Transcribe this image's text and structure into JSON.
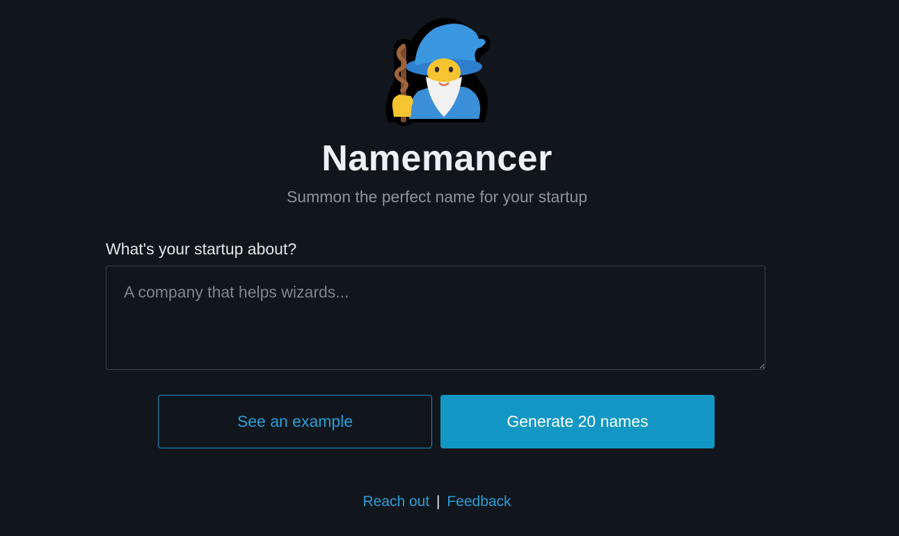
{
  "header": {
    "logo_icon": "mage-wizard-icon",
    "title": "Namemancer",
    "subtitle": "Summon the perfect name for your startup"
  },
  "form": {
    "label": "What's your startup about?",
    "placeholder": "A company that helps wizards...",
    "value": ""
  },
  "actions": {
    "example_label": "See an example",
    "generate_label": "Generate 20 names"
  },
  "footer": {
    "reach_out_label": "Reach out",
    "separator": "|",
    "feedback_label": "Feedback"
  },
  "colors": {
    "background": "#11161d",
    "accent": "#1297c4",
    "link": "#2a9fd6",
    "muted_text": "#8b949e"
  }
}
